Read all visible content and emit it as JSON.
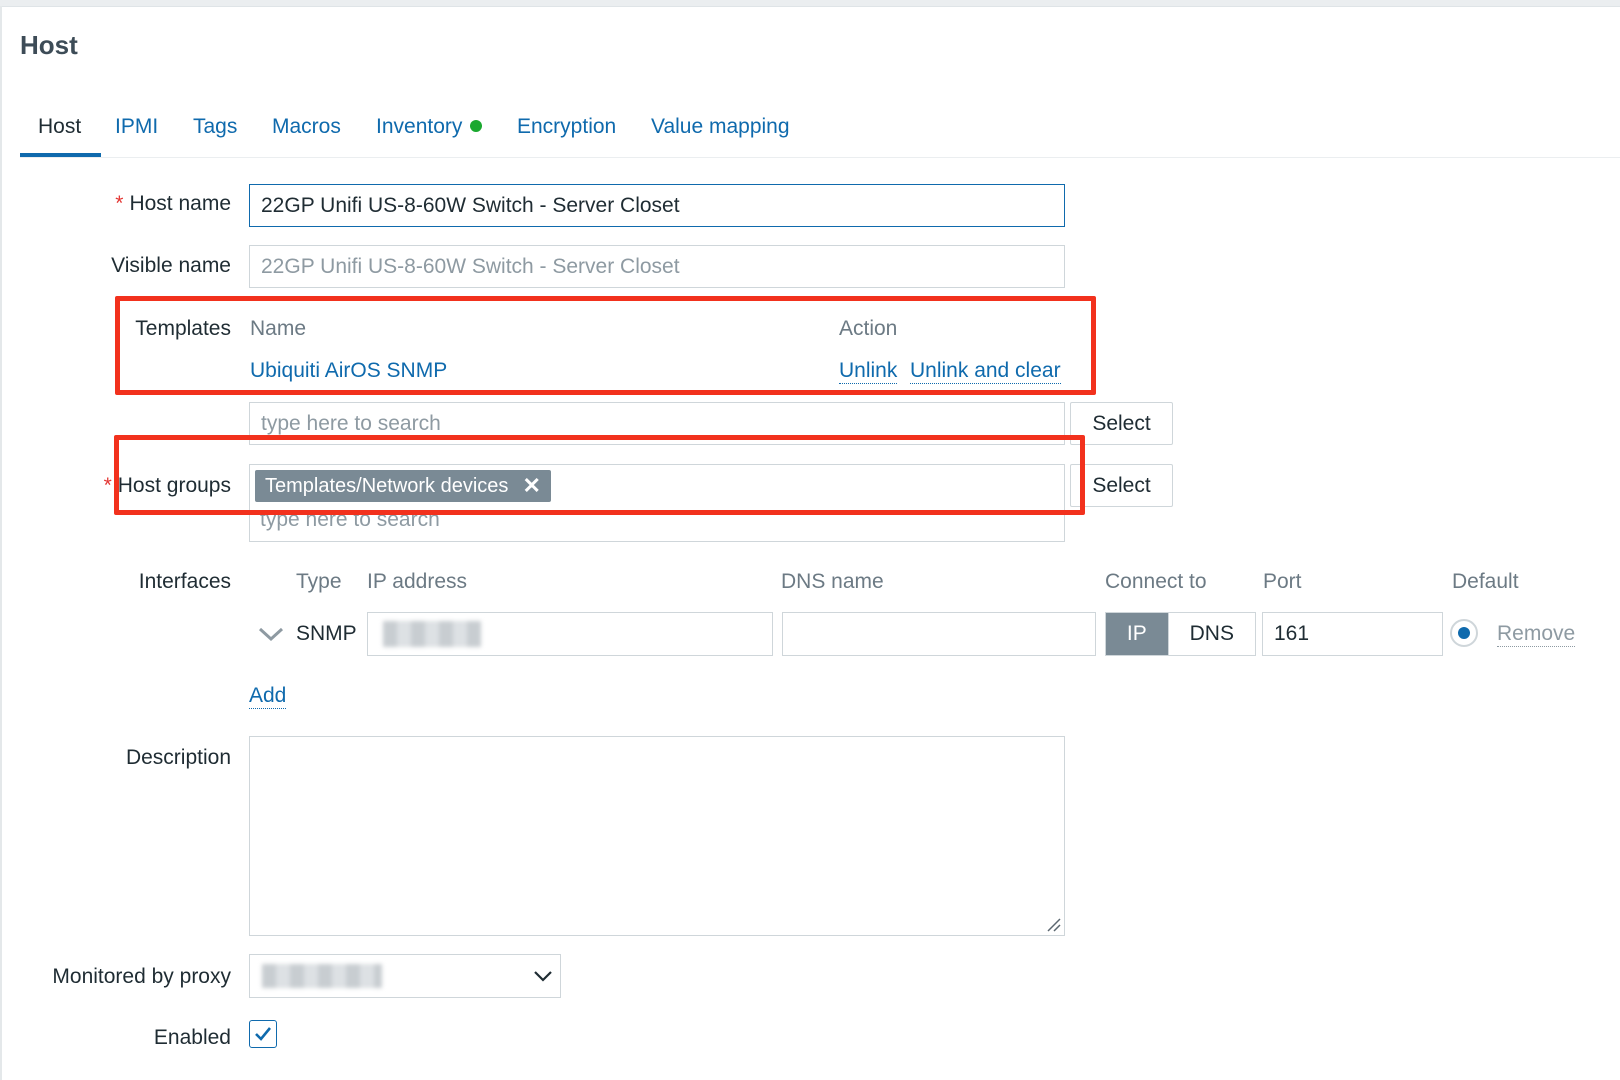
{
  "page": {
    "title": "Host"
  },
  "tabs": [
    {
      "label": "Host",
      "active": true
    },
    {
      "label": "IPMI"
    },
    {
      "label": "Tags"
    },
    {
      "label": "Macros"
    },
    {
      "label": "Inventory",
      "status": "green-dot"
    },
    {
      "label": "Encryption"
    },
    {
      "label": "Value mapping"
    }
  ],
  "form": {
    "host_name": {
      "label": "Host name",
      "required_mark": "*",
      "value": "22GP Unifi US-8-60W Switch - Server Closet"
    },
    "visible_name": {
      "label": "Visible name",
      "placeholder": "22GP Unifi US-8-60W Switch - Server Closet"
    },
    "templates": {
      "label": "Templates",
      "columns": {
        "name": "Name",
        "action": "Action"
      },
      "rows": [
        {
          "name": "Ubiquiti AirOS SNMP",
          "actions": [
            "Unlink",
            "Unlink and clear"
          ]
        }
      ],
      "search_placeholder": "type here to search",
      "select_label": "Select"
    },
    "host_groups": {
      "label": "Host groups",
      "required_mark": "*",
      "chips": [
        "Templates/Network devices"
      ],
      "chip_remove_icon": "close-icon",
      "search_placeholder": "type here to search",
      "select_label": "Select"
    },
    "interfaces": {
      "label": "Interfaces",
      "columns": {
        "type": "Type",
        "ip": "IP address",
        "dns": "DNS name",
        "connect_to": "Connect to",
        "port": "Port",
        "default": "Default"
      },
      "rows": [
        {
          "type": "SNMP",
          "ip": "",
          "dns": "",
          "connect_options": [
            "IP",
            "DNS"
          ],
          "connect_selected": "IP",
          "port": "161",
          "remove_label": "Remove",
          "expand_icon": "chevron-down-icon"
        }
      ],
      "add_label": "Add"
    },
    "description": {
      "label": "Description",
      "value": ""
    },
    "proxy": {
      "label": "Monitored by proxy",
      "value": "",
      "dropdown_icon": "chevron-down-icon"
    },
    "enabled": {
      "label": "Enabled",
      "checked": true
    }
  },
  "colors": {
    "link": "#0f6aad",
    "required": "#e33734",
    "highlight_box": "#f2311d",
    "chip_bg": "#7a8a95",
    "status_green": "#1aa82f"
  }
}
